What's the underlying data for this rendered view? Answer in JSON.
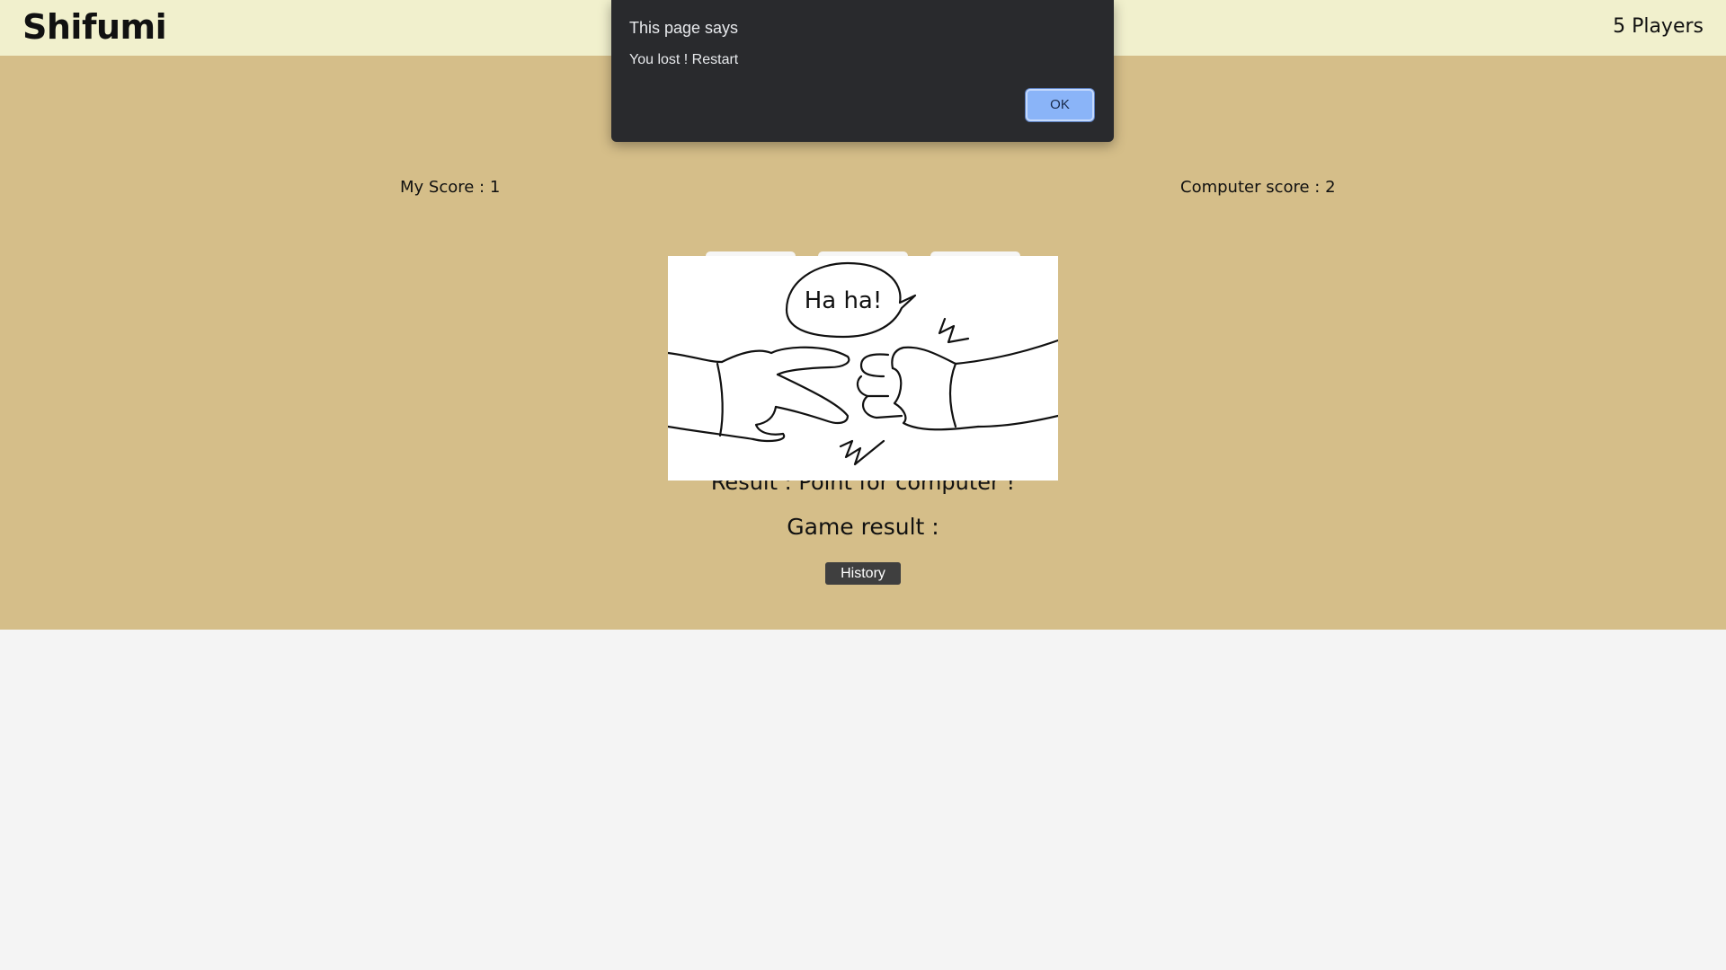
{
  "header": {
    "brand": "Shifumi",
    "players": "5 Players"
  },
  "scores": {
    "my_score": "My Score : 1",
    "computer_score": "Computer score : 2"
  },
  "illustration": {
    "speech": "Ha ha!"
  },
  "round_result": "Result : Point for computer !",
  "game_result": "Game result :",
  "history_button": "History",
  "dialog": {
    "title": "This page says",
    "message": "You lost ! Restart",
    "ok_label": "OK"
  },
  "colors": {
    "header_bg": "#f1f0cd",
    "main_bg": "#d5be89",
    "dialog_bg": "#292a2d",
    "ok_button": "#8ab4f8"
  }
}
